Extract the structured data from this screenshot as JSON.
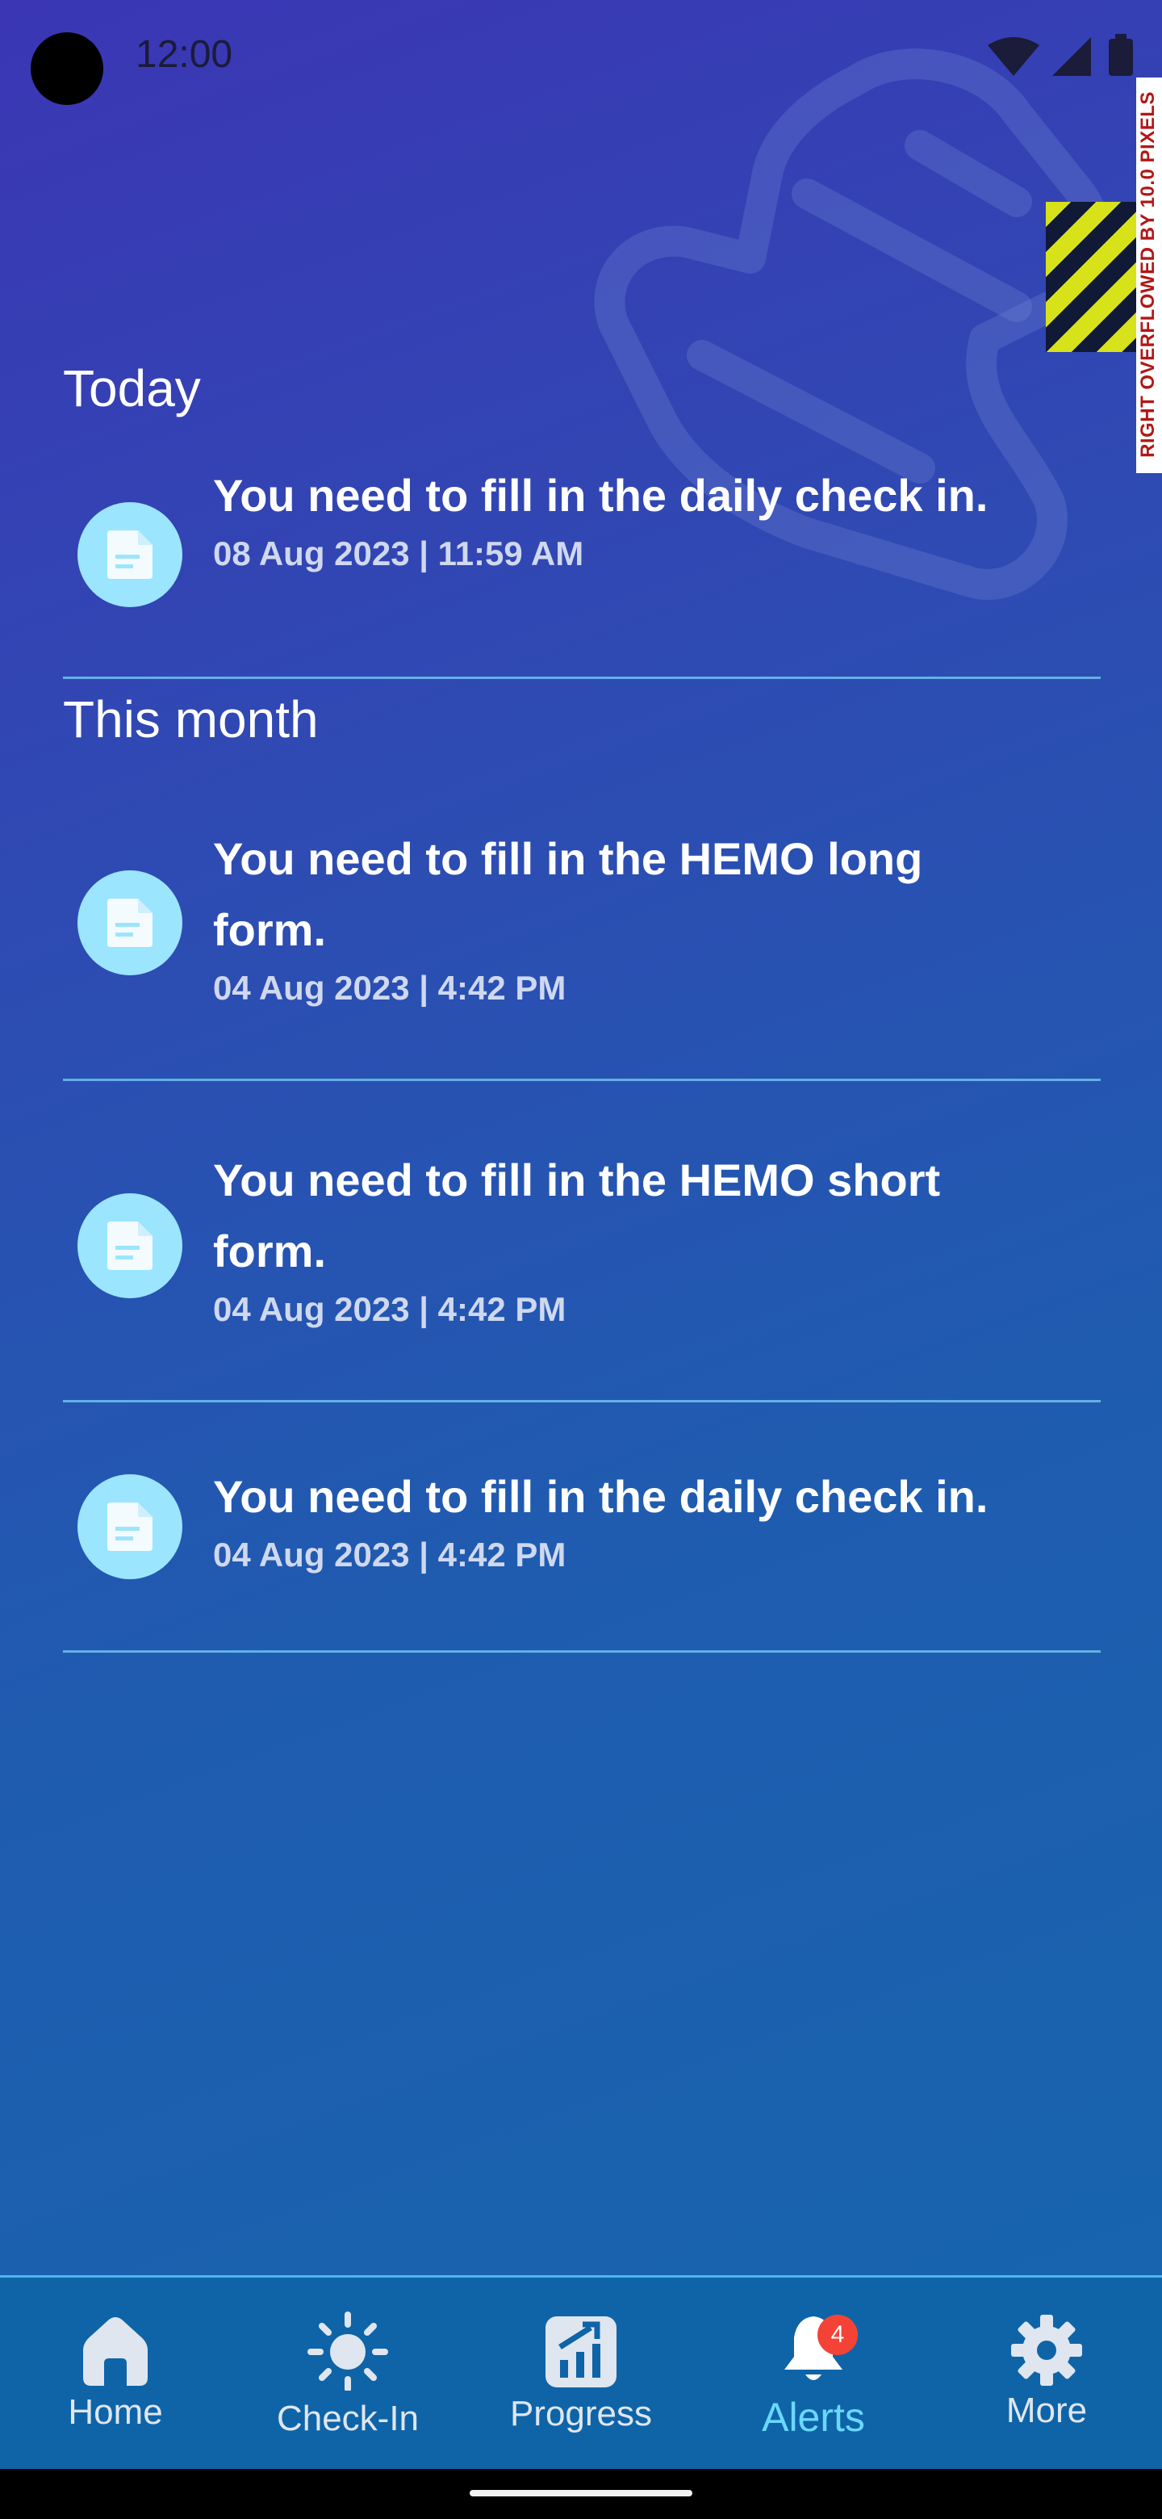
{
  "status_bar": {
    "time": "12:00"
  },
  "debug_overflow": {
    "text": "RIGHT OVERFLOWED BY 10.0 PIXELS"
  },
  "sections": [
    {
      "title": "Today",
      "items": [
        {
          "title": "You need to fill in the daily check in.",
          "date": "08 Aug 2023 | 11:59 AM"
        }
      ]
    },
    {
      "title": "This month",
      "items": [
        {
          "title": "You need to fill in the HEMO long form.",
          "date": "04 Aug 2023 | 4:42 PM"
        },
        {
          "title": "You need to fill in the HEMO short form.",
          "date": "04 Aug 2023 | 4:42 PM"
        },
        {
          "title": "You need to fill in the daily check in.",
          "date": "04 Aug 2023 | 4:42 PM"
        }
      ]
    }
  ],
  "nav": {
    "items": [
      {
        "label": "Home",
        "icon": "home-icon"
      },
      {
        "label": "Check-In",
        "icon": "sun-icon"
      },
      {
        "label": "Progress",
        "icon": "progress-chart-icon"
      },
      {
        "label": "Alerts",
        "icon": "bell-icon",
        "badge": "4",
        "active": true
      },
      {
        "label": "More",
        "icon": "gear-icon"
      }
    ]
  },
  "colors": {
    "accent": "#6ad8ff",
    "icon_bg": "#9be5ff",
    "divider": "#63b0e6",
    "badge": "#f44336",
    "nav_bg": "#0f64a8"
  }
}
